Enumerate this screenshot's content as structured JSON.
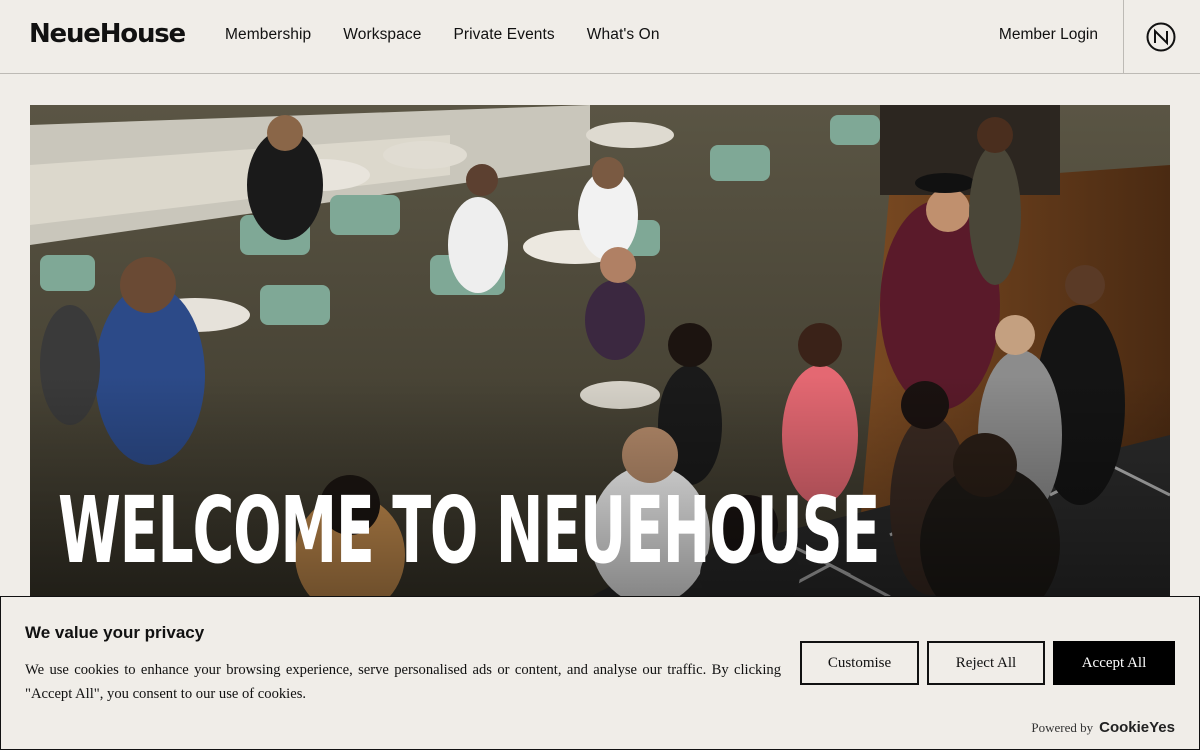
{
  "header": {
    "logo": "NeueHouse",
    "nav": [
      "Membership",
      "Workspace",
      "Private Events",
      "What's On"
    ],
    "member_login": "Member Login",
    "brand_mark_icon": "neuehouse-n-icon"
  },
  "hero": {
    "title": "WELCOME TO NEUEHOUSE"
  },
  "cookie_banner": {
    "title": "We value your privacy",
    "text": "We use cookies to enhance your browsing experience, serve personalised ads or content, and analyse our traffic. By clicking \"Accept All\", you consent to our use of cookies.",
    "buttons": {
      "customise": "Customise",
      "reject": "Reject All",
      "accept": "Accept All"
    },
    "powered_by": "Powered by",
    "powered_brand": "CookieYes"
  },
  "colors": {
    "background": "#f0ede8",
    "text": "#111111",
    "accept_button": "#000000"
  }
}
